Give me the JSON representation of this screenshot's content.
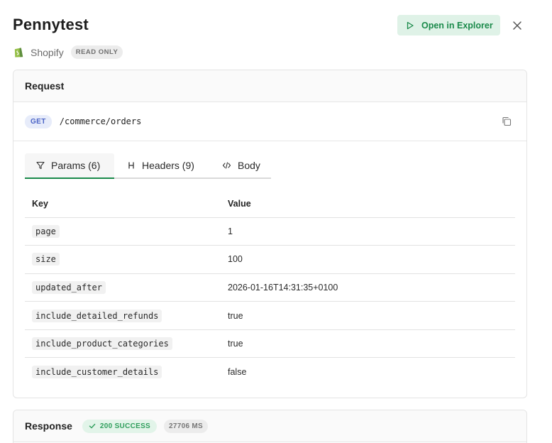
{
  "header": {
    "title": "Pennytest",
    "provider": "Shopify",
    "readonly_badge": "READ ONLY",
    "explorer_button": "Open in Explorer"
  },
  "request": {
    "section_title": "Request",
    "method": "GET",
    "path": "/commerce/orders",
    "tabs": [
      {
        "label": "Params (6)",
        "icon": "filter-icon",
        "active": true
      },
      {
        "label": "Headers (9)",
        "icon": "hash-icon",
        "active": false
      },
      {
        "label": "Body",
        "icon": "code-icon",
        "active": false
      }
    ],
    "table": {
      "columns": [
        "Key",
        "Value"
      ],
      "rows": [
        {
          "key": "page",
          "value": "1"
        },
        {
          "key": "size",
          "value": "100"
        },
        {
          "key": "updated_after",
          "value": "2026-01-16T14:31:35+0100"
        },
        {
          "key": "include_detailed_refunds",
          "value": "true"
        },
        {
          "key": "include_product_categories",
          "value": "true"
        },
        {
          "key": "include_customer_details",
          "value": "false"
        }
      ]
    }
  },
  "response": {
    "section_title": "Response",
    "status": "200 SUCCESS",
    "duration": "27706 MS"
  },
  "colors": {
    "accent_green": "#1a8a4a",
    "method_blue": "#4a63c6"
  }
}
